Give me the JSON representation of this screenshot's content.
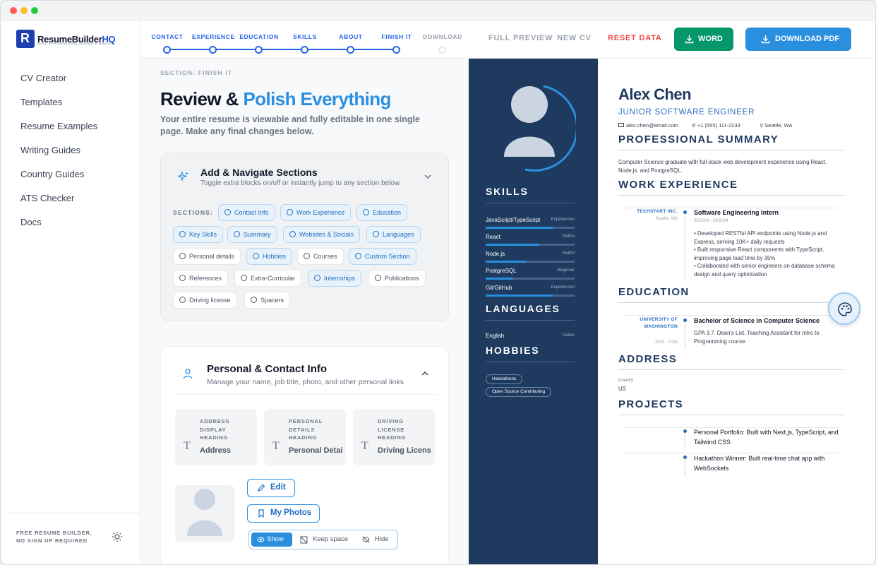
{
  "brand": {
    "name_part1": "ResumeBuilder",
    "name_part2": "HQ",
    "tagline": "BUILD A PROFESSIONAL RESUME IN MINUTES"
  },
  "sidebar": {
    "items": [
      {
        "label": "CV Creator"
      },
      {
        "label": "Templates"
      },
      {
        "label": "Resume Examples"
      },
      {
        "label": "Writing Guides"
      },
      {
        "label": "Country Guides"
      },
      {
        "label": "ATS Checker"
      },
      {
        "label": "Docs"
      }
    ],
    "footer": "FREE RESUME BUILDER, NO SIGN UP REQUIRED"
  },
  "steps": [
    "CONTACT",
    "EXPERIENCE",
    "EDUCATION",
    "SKILLS",
    "ABOUT",
    "FINISH IT",
    "DOWNLOAD"
  ],
  "toolbar": {
    "full_preview": "FULL PREVIEW",
    "new_cv": "NEW CV",
    "reset": "RESET DATA",
    "word": "WORD",
    "pdf": "DOWNLOAD PDF"
  },
  "editor": {
    "section_label": "SECTION: FINISH IT",
    "title_a": "Review & ",
    "title_b": "Polish Everything",
    "subtitle": "Your entire resume is viewable and fully editable in one single page. Make any final changes below.",
    "add_nav": {
      "title": "Add & Navigate Sections",
      "desc": "Toggle extra blocks on/off or instantly jump to any section below",
      "sections_label": "SECTIONS:",
      "chips": [
        {
          "label": "Contact Info"
        },
        {
          "label": "Work Experience"
        },
        {
          "label": "Education"
        },
        {
          "label": "Key Skills"
        },
        {
          "label": "Summary"
        },
        {
          "label": "Websites & Socials"
        },
        {
          "label": "Languages"
        },
        {
          "label": "Personal details"
        },
        {
          "label": "Hobbies"
        },
        {
          "label": "Courses"
        },
        {
          "label": "Custom Section"
        },
        {
          "label": "References"
        },
        {
          "label": "Extra-Curricular"
        },
        {
          "label": "Internships"
        },
        {
          "label": "Publications"
        },
        {
          "label": "Driving license"
        },
        {
          "label": "Spacers"
        }
      ]
    },
    "personal": {
      "title": "Personal & Contact Info",
      "desc": "Manage your name, job title, photo, and other personal links",
      "headings": [
        {
          "label": "ADDRESS DISPLAY HEADING",
          "value": "Address"
        },
        {
          "label": "PERSONAL DETAILS HEADING",
          "value": "Personal Details"
        },
        {
          "label": "DRIVING LICENSE HEADING",
          "value": "Driving License"
        }
      ],
      "edit": "Edit",
      "my_photos": "My Photos",
      "show": "Show",
      "keep_space": "Keep space",
      "hide": "Hide"
    }
  },
  "resume": {
    "name": "Alex Chen",
    "job_title": "JUNIOR SOFTWARE ENGINEER",
    "email": "alex.chen@email.com",
    "phone": "+1 (555) 111-2233",
    "location": "Seattle, WA",
    "headings": {
      "skills": "SKILLS",
      "languages": "LANGUAGES",
      "hobbies": "HOBBIES",
      "summary": "PROFESSIONAL SUMMARY",
      "work": "WORK EXPERIENCE",
      "education": "EDUCATION",
      "address": "ADDRESS",
      "projects": "PROJECTS"
    },
    "skills": [
      {
        "name": "JavaScript/TypeScript",
        "level": "Experienced",
        "pct": 0.75
      },
      {
        "name": "React",
        "level": "Skillful",
        "pct": 0.6
      },
      {
        "name": "Node.js",
        "level": "Skillful",
        "pct": 0.45
      },
      {
        "name": "PostgreSQL",
        "level": "Beginner",
        "pct": 0.3
      },
      {
        "name": "Git/GitHub",
        "level": "Experienced",
        "pct": 0.75
      }
    ],
    "languages": [
      {
        "name": "English",
        "level": "Native"
      }
    ],
    "hobbies": [
      "Hackathons",
      "Open Source Contributing"
    ],
    "summary": "Computer Science graduate with full-stack web development experience using React, Node.js, and PostgreSQL.",
    "work": {
      "org": "TECHSTART INC.",
      "loc": "Seattle, WA",
      "role": "Software Engineering Intern",
      "dates": "06/2024 - 08/2024",
      "bullets": "• Developed RESTful API endpoints using Node.js and Express, serving 10K+ daily requests\n• Built responsive React components with TypeScript, improving page load time by 35%\n• Collaborated with senior engineers on database schema design and query optimization"
    },
    "education": {
      "org": "UNIVERSITY OF WASHINGTON",
      "dates": "2020 - 2024",
      "degree": "Bachelor of Science in Computer Science",
      "desc": "GPA 3.7. Dean's List. Teaching Assistant for Intro to Programming course."
    },
    "address": {
      "label": "Country",
      "value": "US"
    },
    "projects": [
      {
        "title": "Personal Portfolio: Built with Next.js, TypeScript, and Tailwind CSS"
      },
      {
        "title": "Hackathon Winner: Built real-time chat app with WebSockets"
      }
    ]
  },
  "colors": {
    "accent": "#2b8fe0",
    "resume_sidebar": "#1e3a5f",
    "word": "#059669",
    "reset": "#ef4444"
  }
}
